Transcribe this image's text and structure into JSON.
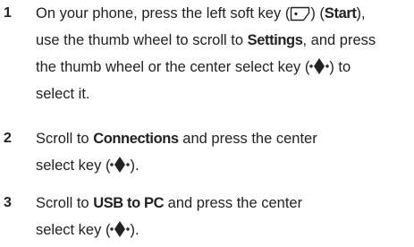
{
  "steps": [
    {
      "number": "1",
      "t1": "On your phone, press the left soft key (",
      "t2": ") (",
      "t3": "Start",
      "t4": "),",
      "t5": "use the thumb wheel to scroll to ",
      "t6": "Settings",
      "t7": ", and press",
      "t8": "the thumb wheel or the center select key (",
      "t9": ") to",
      "t10": "select it."
    },
    {
      "number": "2",
      "t1": "Scroll to ",
      "t2": "Connections",
      "t3": " and press the center",
      "t4": "select key (",
      "t5": ")."
    },
    {
      "number": "3",
      "t1": "Scroll to ",
      "t2": "USB to PC",
      "t3": " and press the center",
      "t4": "select key (",
      "t5": ")."
    }
  ],
  "icons": {
    "soft_key": "left-soft-key-icon",
    "select_key": "center-select-key-icon"
  },
  "colors": {
    "text": "#222222"
  }
}
